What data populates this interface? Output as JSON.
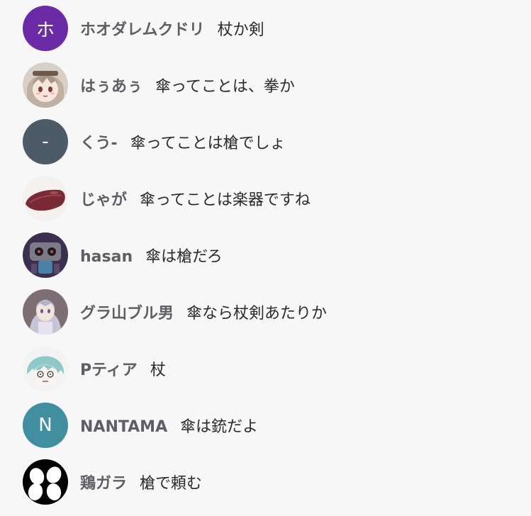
{
  "comments": [
    {
      "name": "ホオダレムクドリ",
      "message": "杖か剣",
      "avatar": {
        "type": "initial",
        "initial": "ホ",
        "color": "#6b2aa6"
      }
    },
    {
      "name": "はぅあぅ",
      "message": "傘ってことは、拳か",
      "avatar": {
        "type": "image",
        "icon": "anime-girl-icon"
      }
    },
    {
      "name": "くう-",
      "message": "傘ってことは槍でしょ",
      "avatar": {
        "type": "initial",
        "initial": "-",
        "color": "#4d5a68"
      }
    },
    {
      "name": "じゃが",
      "message": "傘ってことは楽器ですね",
      "avatar": {
        "type": "image",
        "icon": "sweet-potato-icon"
      }
    },
    {
      "name": "hasan",
      "message": "傘は槍だろ",
      "avatar": {
        "type": "image",
        "icon": "robot-character-icon"
      }
    },
    {
      "name": "グラ山ブル男",
      "message": "傘なら杖剣あたりか",
      "avatar": {
        "type": "image",
        "icon": "silver-hair-girl-icon"
      }
    },
    {
      "name": "Pティア",
      "message": "杖",
      "avatar": {
        "type": "image",
        "icon": "teal-hair-character-icon"
      }
    },
    {
      "name": "NANTAMA",
      "message": "傘は銃だよ",
      "avatar": {
        "type": "initial",
        "initial": "N",
        "color": "#3f8fa0"
      }
    },
    {
      "name": "鶏ガラ",
      "message": "槍で頼む",
      "avatar": {
        "type": "image",
        "icon": "eggs-icon"
      }
    }
  ]
}
